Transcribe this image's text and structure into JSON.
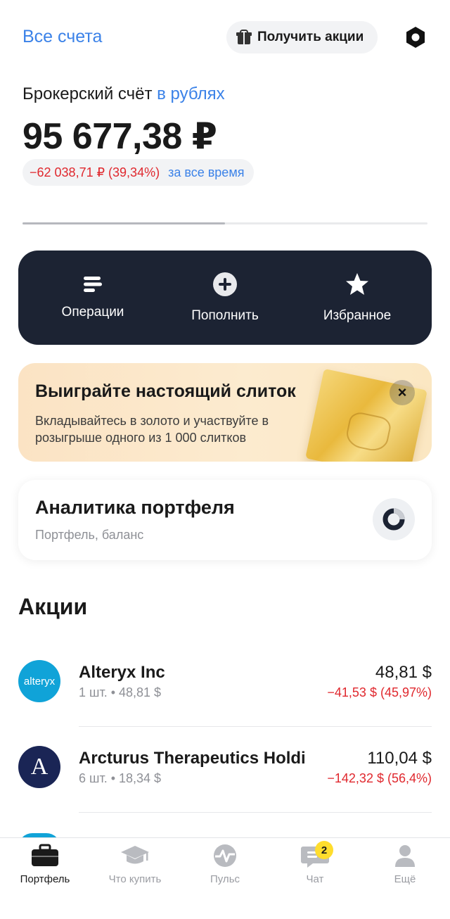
{
  "header": {
    "all_accounts": "Все счета",
    "get_shares": "Получить акции"
  },
  "account": {
    "title_prefix": "Брокерский счёт",
    "title_currency": "в рублях",
    "balance": "95 677,38 ₽",
    "change_value": "−62 038,71 ₽ (39,34%)",
    "change_period": "за все время",
    "progress_fraction": 0.5
  },
  "actions": [
    {
      "label": "Операции"
    },
    {
      "label": "Пополнить"
    },
    {
      "label": "Избранное"
    }
  ],
  "promo": {
    "title": "Выиграйте настоящий слиток",
    "text": "Вкладывайтесь в золото и участвуйте в розыгрыше одного из 1 000 слитков"
  },
  "analytics": {
    "title": "Аналитика портфеля",
    "subtitle": "Портфель, баланс"
  },
  "section": {
    "title": "Акции"
  },
  "stocks": [
    {
      "logo_text": "alteryx",
      "name": "Alteryx Inc",
      "meta": "1 шт. • 48,81 $",
      "price": "48,81 $",
      "pl": "−41,53 $ (45,97%)"
    },
    {
      "logo_text": "A",
      "name": "Arcturus Therapeutics Holdi",
      "meta": "6 шт. • 18,34 $",
      "price": "110,04 $",
      "pl": "−142,32 $ (56,4%)"
    }
  ],
  "tabbar": {
    "tabs": [
      {
        "label": "Портфель",
        "icon": "briefcase-icon"
      },
      {
        "label": "Что купить",
        "icon": "graduation-cap-icon"
      },
      {
        "label": "Пульс",
        "icon": "pulse-icon"
      },
      {
        "label": "Чат",
        "icon": "chat-icon",
        "badge": "2"
      },
      {
        "label": "Ещё",
        "icon": "profile-icon"
      }
    ]
  },
  "colors": {
    "accent": "#3b82e8",
    "negative": "#e0282e",
    "dark_panel": "#1c2333",
    "badge": "#ffdd2d"
  }
}
